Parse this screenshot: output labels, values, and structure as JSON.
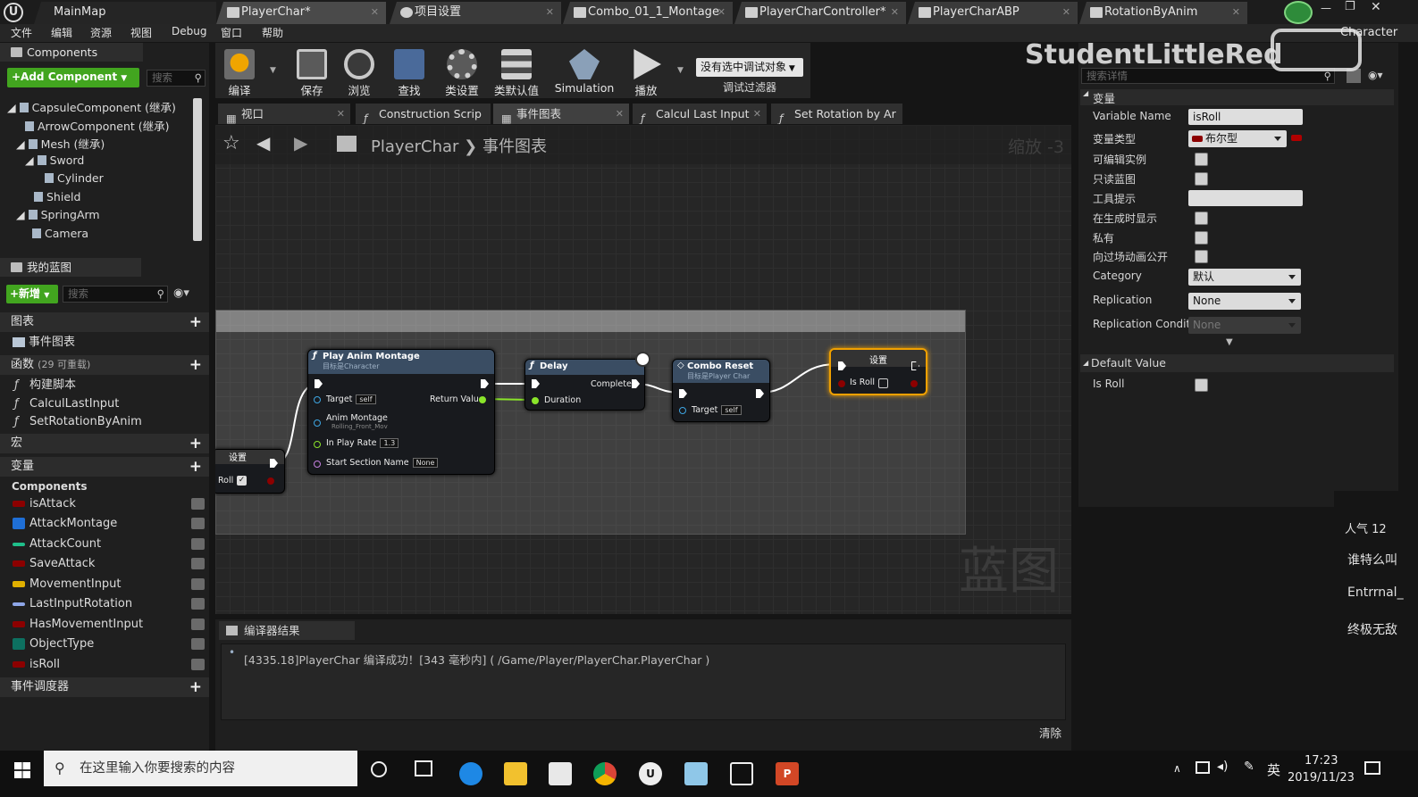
{
  "titlebar": {
    "tabs": [
      {
        "label": "MainMap"
      },
      {
        "label": "PlayerChar*"
      },
      {
        "label": "项目设置"
      },
      {
        "label": "Combo_01_1_Montage"
      },
      {
        "label": "PlayerCharController*"
      },
      {
        "label": "PlayerCharABP"
      },
      {
        "label": "RotationByAnim"
      }
    ],
    "right_label": "Character",
    "watermark": "StudentLittleRed"
  },
  "menubar": {
    "items": [
      "文件",
      "编辑",
      "资源",
      "视图",
      "Debug",
      "窗口",
      "帮助"
    ]
  },
  "components_panel": {
    "title": "Components",
    "add_button": "+Add Component",
    "search_placeholder": "搜索",
    "tree": [
      {
        "label": "CapsuleComponent (继承)"
      },
      {
        "label": "ArrowComponent (继承)"
      },
      {
        "label": "Mesh (继承)"
      },
      {
        "label": "Sword"
      },
      {
        "label": "Cylinder"
      },
      {
        "label": "Shield"
      },
      {
        "label": "SpringArm"
      },
      {
        "label": "Camera"
      }
    ]
  },
  "my_blueprint": {
    "title": "我的蓝图",
    "new_button": "+新增",
    "search_placeholder": "搜索",
    "sections": {
      "graphs": "图表",
      "event_graph": "事件图表",
      "functions": "函数",
      "functions_count": "(29 可重载)",
      "macros": "宏",
      "variables": "变量",
      "components": "Components",
      "dispatchers": "事件调度器"
    },
    "functions": [
      "构建脚本",
      "CalculLastInput",
      "SetRotationByAnim"
    ],
    "variables": [
      {
        "name": "isAttack",
        "color": "#8c0000"
      },
      {
        "name": "AttackMontage",
        "color": "#1f6fd6"
      },
      {
        "name": "AttackCount",
        "color": "#1fbf8a"
      },
      {
        "name": "SaveAttack",
        "color": "#8c0000"
      },
      {
        "name": "MovementInput",
        "color": "#e0b000"
      },
      {
        "name": "LastInputRotation",
        "color": "#8ea6e8"
      },
      {
        "name": "HasMovementInput",
        "color": "#8c0000"
      },
      {
        "name": "ObjectType",
        "color": "#0d7060"
      },
      {
        "name": "isRoll",
        "color": "#8c0000"
      }
    ]
  },
  "toolbar": {
    "buttons": [
      {
        "label": "编译",
        "icon": "compile-icon"
      },
      {
        "label": "保存",
        "icon": "save-icon"
      },
      {
        "label": "浏览",
        "icon": "browse-icon"
      },
      {
        "label": "查找",
        "icon": "find-icon"
      },
      {
        "label": "类设置",
        "icon": "class-settings-icon"
      },
      {
        "label": "类默认值",
        "icon": "class-defaults-icon"
      },
      {
        "label": "Simulation",
        "icon": "simulation-icon"
      },
      {
        "label": "播放",
        "icon": "play-icon"
      }
    ],
    "debug_select": "没有选中调试对象",
    "debug_filter": "调试过滤器"
  },
  "graph_tabs": [
    {
      "label": "视口"
    },
    {
      "label": "Construction Scrip"
    },
    {
      "label": "事件图表"
    },
    {
      "label": "Calcul Last Input"
    },
    {
      "label": "Set Rotation by Ar"
    }
  ],
  "graph": {
    "breadcrumb_root": "PlayerChar",
    "breadcrumb_current": "事件图表",
    "zoom": "缩放 -3",
    "watermark": "蓝图",
    "nodes": {
      "set_left": {
        "title": "设置",
        "pin": "Roll"
      },
      "play_montage": {
        "title": "Play Anim Montage",
        "subtitle": "目标是Character",
        "target": "Target",
        "target_value": "self",
        "montage": "Anim Montage",
        "montage_value": "Rolling_Front_Mov",
        "rate": "In Play Rate",
        "rate_value": "1.3",
        "section": "Start Section Name",
        "section_value": "None",
        "return": "Return Value"
      },
      "delay": {
        "title": "Delay",
        "completed": "Completed",
        "duration": "Duration"
      },
      "combo_reset": {
        "title": "Combo Reset",
        "subtitle": "目标是Player Char",
        "target": "Target",
        "target_value": "self"
      },
      "set_right": {
        "title": "设置",
        "pin": "Is Roll"
      }
    }
  },
  "compiler": {
    "tab": "编译器结果",
    "message": "[4335.18]PlayerChar 编译成功！[343 毫秒内] ( /Game/Player/PlayerChar.PlayerChar )",
    "clear": "清除"
  },
  "details": {
    "search_placeholder": "搜索详情",
    "section_variable": "变量",
    "variable_name_label": "Variable Name",
    "variable_name": "isRoll",
    "variable_type_label": "变量类型",
    "variable_type": "布尔型",
    "rows": [
      "可编辑实例",
      "只读蓝图",
      "工具提示",
      "在生成时显示",
      "私有",
      "向过场动画公开"
    ],
    "category_label": "Category",
    "category": "默认",
    "replication_label": "Replication",
    "replication": "None",
    "replication_cond_label": "Replication Conditi",
    "replication_cond": "None",
    "default_value_section": "Default Value",
    "default_is_roll": "Is Roll"
  },
  "danmaku": {
    "popularity": "人气 12",
    "comments": [
      "谁特么叫",
      "Entrrnal_",
      "终极无敌"
    ]
  },
  "taskbar": {
    "search_placeholder": "在这里输入你要搜索的内容",
    "ime": "英",
    "time": "17:23",
    "date": "2019/11/23"
  },
  "colors": {
    "accent_green": "#42a51f",
    "node_header": "#3a4d63",
    "bool_red": "#8c0000"
  }
}
